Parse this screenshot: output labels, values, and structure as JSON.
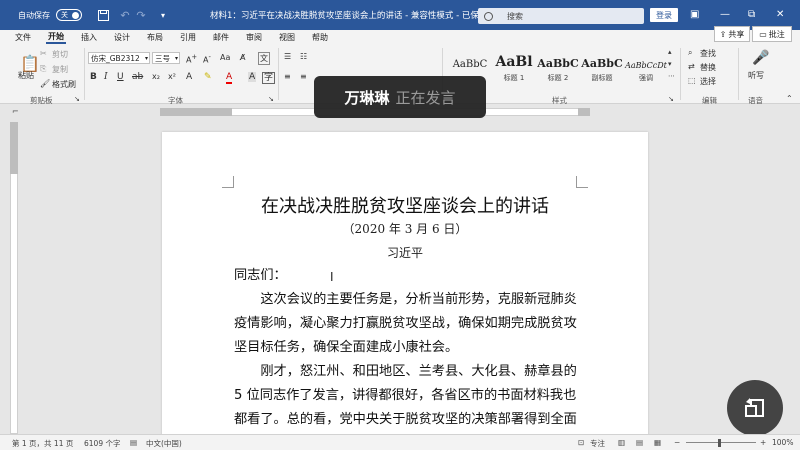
{
  "titlebar": {
    "autosave_label": "自动保存",
    "autosave_state": "关",
    "doc_title": "材料1：习近平在决战决胜脱贫攻坚座谈会上的讲话 - 兼容性模式 - 已保存",
    "search_placeholder": "搜索",
    "login_label": "登录",
    "minimize": "—",
    "restore": "⧉",
    "close": "✕",
    "brand_color": "#2b579a"
  },
  "menu": {
    "tabs": [
      "文件",
      "开始",
      "插入",
      "设计",
      "布局",
      "引用",
      "邮件",
      "审阅",
      "视图",
      "帮助"
    ],
    "active_index": 1,
    "share_label": "共享",
    "comment_label": "批注"
  },
  "ribbon": {
    "clipboard": {
      "paste": "粘贴",
      "cut": "剪切",
      "copy": "复制",
      "format_painter": "格式刷",
      "group": "剪贴板"
    },
    "font": {
      "name": "仿宋_GB2312",
      "size": "三号",
      "bold": "B",
      "italic": "I",
      "underline": "U",
      "group": "字体"
    },
    "paragraph": {
      "group": "段落"
    },
    "styles": {
      "items": [
        {
          "sample": "AaBbC",
          "name": ""
        },
        {
          "sample": "AaBl",
          "name": "标题 1"
        },
        {
          "sample": "AaBbC",
          "name": "标题 2"
        },
        {
          "sample": "AaBbC",
          "name": "副标题"
        },
        {
          "sample": "AaBbCcDt",
          "name": "强调"
        }
      ],
      "group": "样式"
    },
    "editing": {
      "find": "查找",
      "replace": "替换",
      "select": "选择",
      "group": "编辑"
    },
    "voice": {
      "dictate": "听写",
      "group": "语音"
    }
  },
  "overlay": {
    "speaker_name": "万琳琳",
    "speaker_status": "正在发言"
  },
  "document": {
    "heading": "在决战决胜脱贫攻坚座谈会上的讲话",
    "date": "（2020 年 3 月 6 日）",
    "author": "习近平",
    "lines": [
      "同志们：",
      "　　这次会议的主要任务是，分析当前形势，克服新冠肺炎",
      "疫情影响，凝心聚力打赢脱贫攻坚战，确保如期完成脱贫攻",
      "坚目标任务，确保全面建成小康社会。",
      "　　刚才，怒江州、和田地区、兰考县、大化县、赫章县的",
      "5 位同志作了发言，讲得都很好，各省区市的书面材料我也",
      "都看了。总的看，党中央关于脱贫攻坚的决策部署得到全面"
    ]
  },
  "statusbar": {
    "page": "第 1 页，共 11 页",
    "words": "6109 个字",
    "language": "中文(中国)",
    "focus": "专注",
    "zoom": "100%"
  }
}
